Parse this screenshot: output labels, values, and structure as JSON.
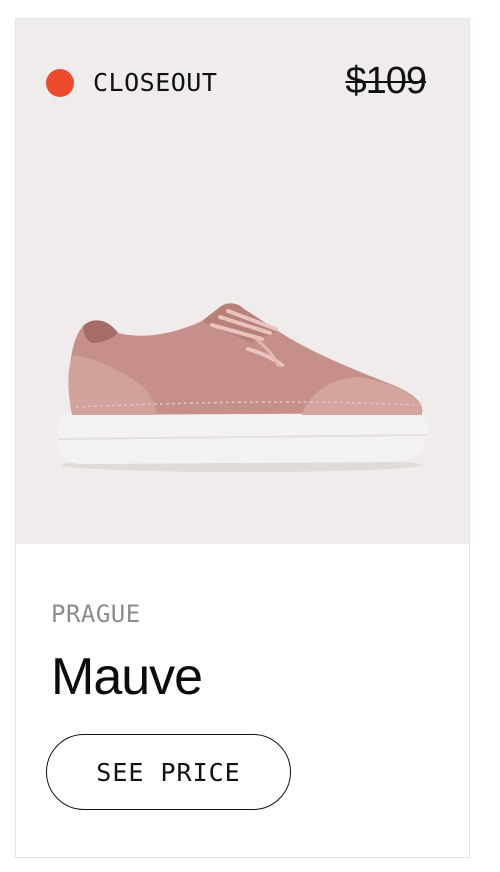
{
  "card": {
    "badge": {
      "label": "CLOSEOUT",
      "dot_color": "#ee4a2c"
    },
    "old_price": "$109",
    "image": {
      "icon": "sneaker-image",
      "shoe_color": "#c99590"
    },
    "brand": "PRAGUE",
    "name": "Mauve",
    "cta_label": "SEE PRICE"
  }
}
